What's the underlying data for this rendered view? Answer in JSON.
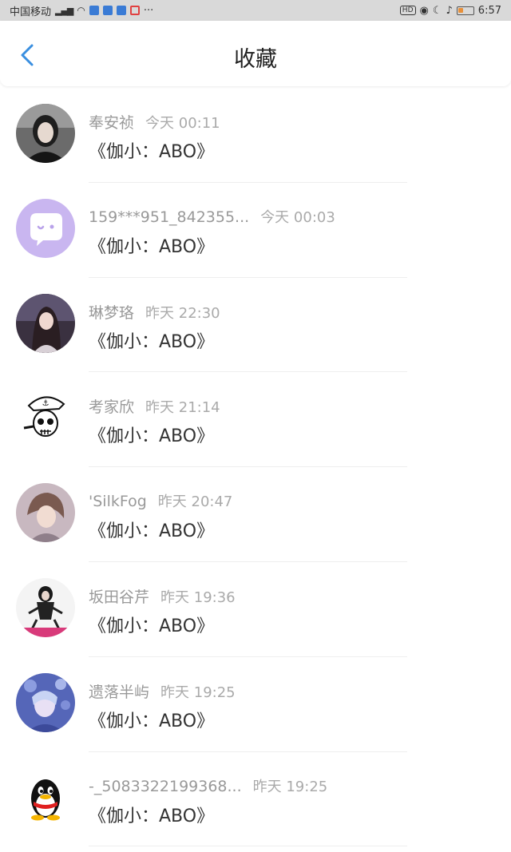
{
  "status_bar": {
    "carrier": "中国移动",
    "network": "4G",
    "time": "6:57",
    "badge_hd": "HD",
    "more": "···"
  },
  "header": {
    "title": "收藏",
    "back_icon": "chevron-left-icon"
  },
  "colors": {
    "accent": "#3a8fe0",
    "name_gray": "#999999",
    "text_dark": "#333333"
  },
  "items": [
    {
      "name": "奉安祯",
      "time": "今天 00:11",
      "content": "《伽小：ABO》",
      "avatar": "photo-woman"
    },
    {
      "name": "159***951_842355...",
      "time": "今天 00:03",
      "content": "《伽小：ABO》",
      "avatar": "chat-bubble-purple"
    },
    {
      "name": "琳梦珞",
      "time": "昨天 22:30",
      "content": "《伽小：ABO》",
      "avatar": "anime-girl-dark"
    },
    {
      "name": "考家欣",
      "time": "昨天 21:14",
      "content": "《伽小：ABO》",
      "avatar": "skull-sailor"
    },
    {
      "name": "'SilkFog",
      "time": "昨天 20:47",
      "content": "《伽小：ABO》",
      "avatar": "anime-boy"
    },
    {
      "name": "坂田谷芹",
      "time": "昨天 19:36",
      "content": "《伽小：ABO》",
      "avatar": "photo-sitting-woman"
    },
    {
      "name": "遗落半屿",
      "time": "昨天 19:25",
      "content": "《伽小：ABO》",
      "avatar": "anime-blue-flowers"
    },
    {
      "name": "-_5083322199368...",
      "time": "昨天 19:25",
      "content": "《伽小：ABO》",
      "avatar": "qq-penguin"
    }
  ]
}
